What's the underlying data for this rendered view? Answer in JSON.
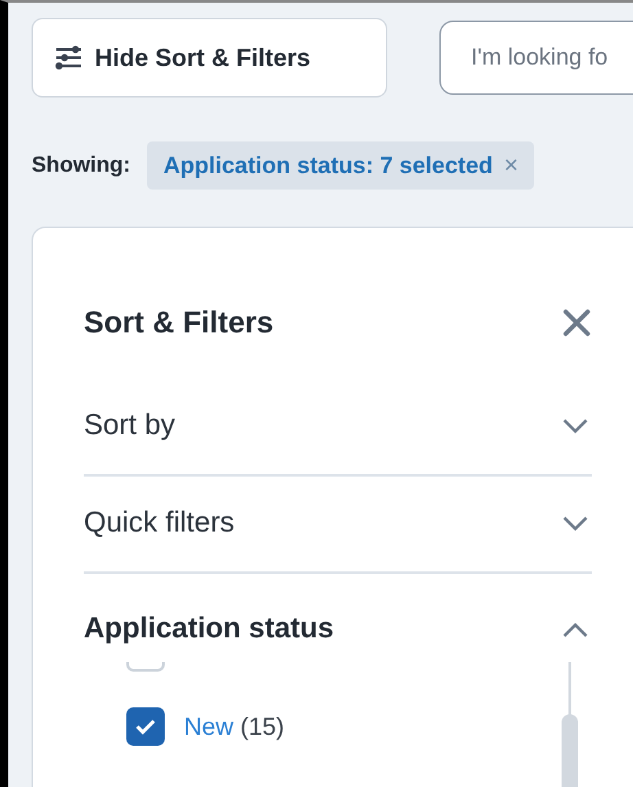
{
  "toolbar": {
    "toggle_button": "Hide Sort & Filters",
    "search": {
      "placeholder": "I'm looking fo"
    }
  },
  "showing": {
    "label": "Showing:",
    "chip": "Application status: 7 selected",
    "chip_remove": "×"
  },
  "panel": {
    "title": "Sort & Filters",
    "sections": [
      {
        "label": "Sort by",
        "expanded": false
      },
      {
        "label": "Quick filters",
        "expanded": false
      },
      {
        "label": "Application status",
        "expanded": true,
        "options": [
          {
            "checked": false
          },
          {
            "label": "New",
            "count": "(15)",
            "checked": true
          }
        ]
      }
    ]
  }
}
